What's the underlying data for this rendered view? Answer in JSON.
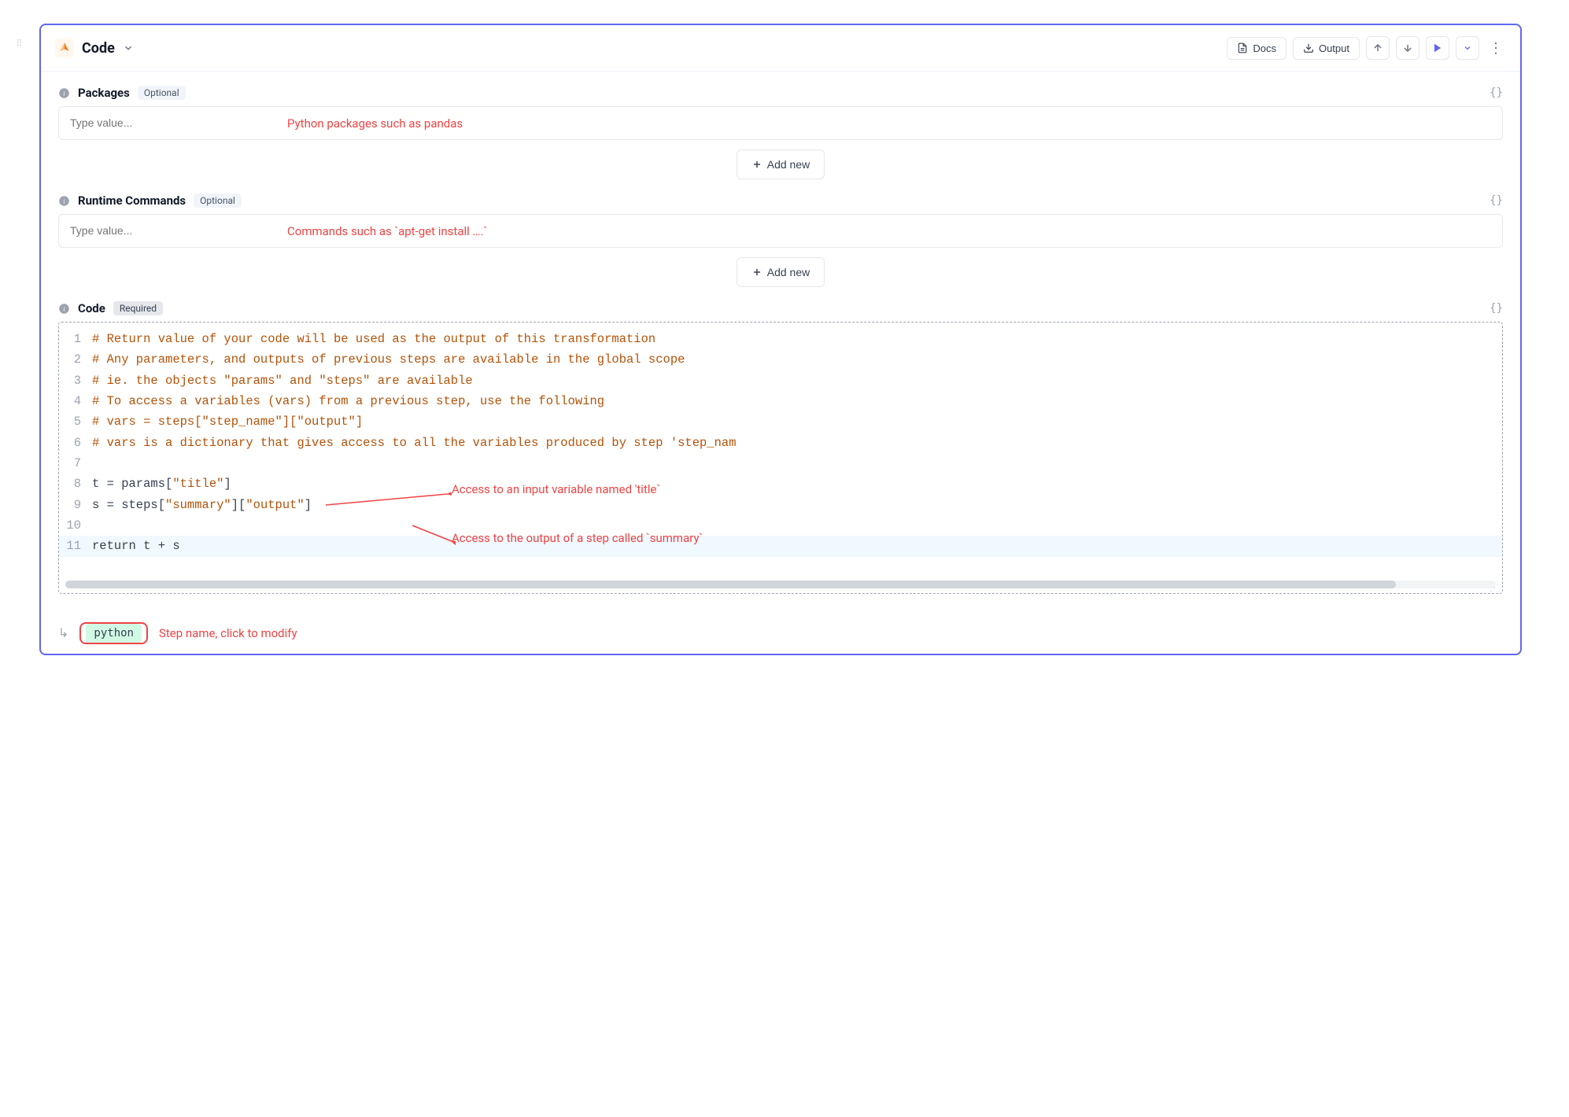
{
  "header": {
    "title": "Code",
    "docs_label": "Docs",
    "output_label": "Output"
  },
  "sections": {
    "packages": {
      "title": "Packages",
      "badge": "Optional",
      "placeholder": "Type value...",
      "annotation": "Python packages such as pandas",
      "add_label": "Add new"
    },
    "runtime": {
      "title": "Runtime Commands",
      "badge": "Optional",
      "placeholder": "Type value...",
      "annotation": "Commands such as `apt-get install ….`",
      "add_label": "Add new"
    },
    "code": {
      "title": "Code",
      "badge": "Required"
    }
  },
  "code_lines": [
    "# Return value of your code will be used as the output of this transformation",
    "# Any parameters, and outputs of previous steps are available in the global scope",
    "# ie. the objects \"params\" and \"steps\" are available",
    "# To access a variables (vars) from a previous step, use the following",
    "# vars = steps[\"step_name\"][\"output\"]",
    "# vars is a dictionary that gives access to all the variables produced by step 'step_nam",
    "",
    "t = params[\"title\"]",
    "s = steps[\"summary\"][\"output\"]",
    "",
    "return t + s"
  ],
  "code_annotations": {
    "a1": "Access to an input variable  named 'title`",
    "a2": "Access to the output of a step called `summary`"
  },
  "footer": {
    "step_name": "python",
    "annotation": "Step name, click to modify"
  }
}
